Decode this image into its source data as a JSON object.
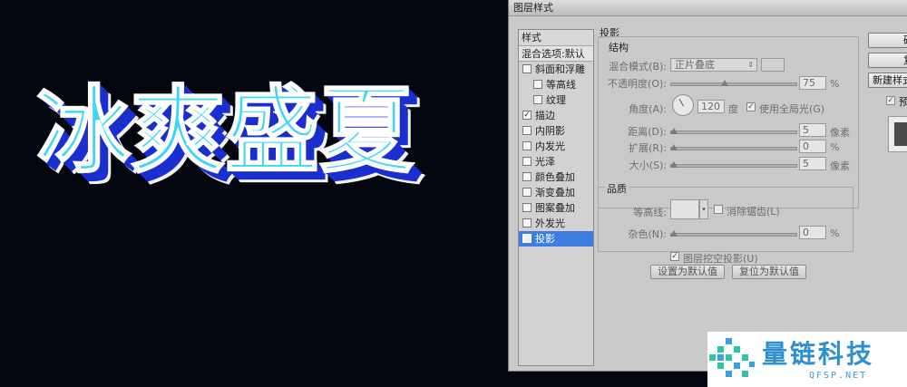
{
  "canvas": {
    "headline": "冰爽盛夏"
  },
  "dialog": {
    "title": "图层样式",
    "styles_header": "样式",
    "blend_options": "混合选项:默认",
    "items": [
      {
        "label": "斜面和浮雕",
        "checked": false,
        "sub": false
      },
      {
        "label": "等高线",
        "checked": false,
        "sub": true
      },
      {
        "label": "纹理",
        "checked": false,
        "sub": true
      },
      {
        "label": "描边",
        "checked": true,
        "sub": false
      },
      {
        "label": "内阴影",
        "checked": false,
        "sub": false
      },
      {
        "label": "内发光",
        "checked": false,
        "sub": false
      },
      {
        "label": "光泽",
        "checked": false,
        "sub": false
      },
      {
        "label": "颜色叠加",
        "checked": false,
        "sub": false
      },
      {
        "label": "渐变叠加",
        "checked": false,
        "sub": false
      },
      {
        "label": "图案叠加",
        "checked": false,
        "sub": false
      },
      {
        "label": "外发光",
        "checked": false,
        "sub": false
      },
      {
        "label": "投影",
        "checked": false,
        "sub": false,
        "selected": true
      }
    ],
    "drop_shadow": {
      "section_title": "投影",
      "structure_title": "结构",
      "blend_mode_label": "混合模式(B):",
      "blend_mode_value": "正片叠底",
      "opacity_label": "不透明度(O):",
      "opacity_value": "75",
      "opacity_unit": "%",
      "angle_label": "角度(A):",
      "angle_value": "120",
      "angle_unit": "度",
      "global_light_label": "使用全局光(G)",
      "distance_label": "距离(D):",
      "distance_value": "5",
      "distance_unit": "像素",
      "spread_label": "扩展(R):",
      "spread_value": "0",
      "spread_unit": "%",
      "size_label": "大小(S):",
      "size_value": "5",
      "size_unit": "像素",
      "quality_title": "品质",
      "contour_label": "等高线:",
      "anti_alias_label": "消除锯齿(L)",
      "noise_label": "杂色(N):",
      "noise_value": "0",
      "noise_unit": "%",
      "layer_knocks_out_label": "图层挖空投影(U)",
      "make_default_button": "设置为默认值",
      "reset_default_button": "复位为默认值"
    },
    "right_buttons": [
      "确定",
      "复位",
      "新建样式..."
    ],
    "preview_label": "预览"
  },
  "watermark": {
    "name": "量链科技",
    "url": "QFSP.NET"
  }
}
